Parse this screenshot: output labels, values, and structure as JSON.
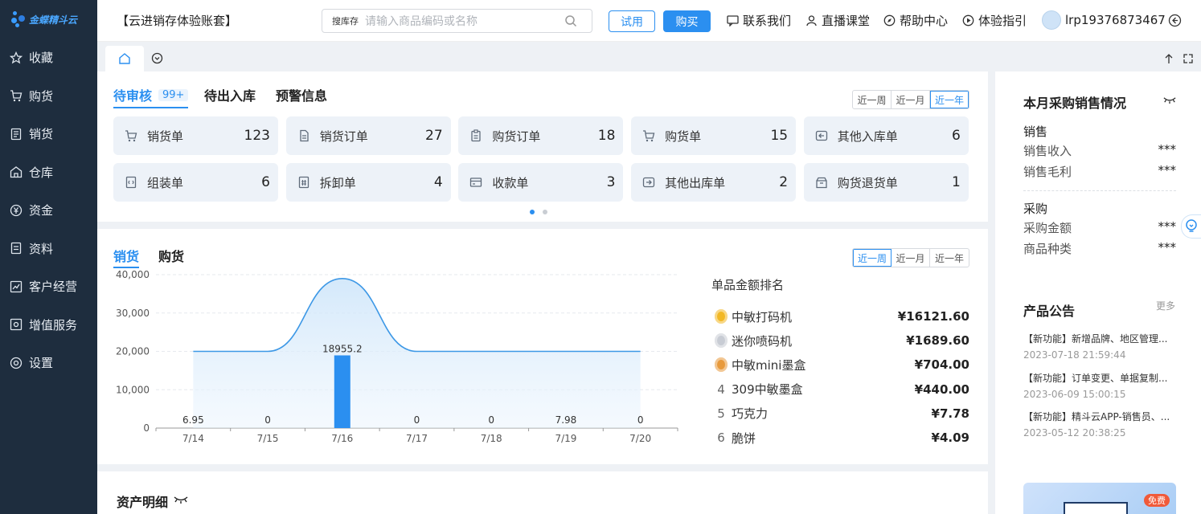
{
  "app": {
    "logo_text": "金蝶精斗云",
    "account_title": "【云进销存体验账套】"
  },
  "sidebar": {
    "items": [
      {
        "label": "收藏",
        "icon": "star-icon"
      },
      {
        "label": "购货",
        "icon": "cart-icon"
      },
      {
        "label": "销货",
        "icon": "receipt-icon"
      },
      {
        "label": "仓库",
        "icon": "warehouse-icon"
      },
      {
        "label": "资金",
        "icon": "yen-icon"
      },
      {
        "label": "资料",
        "icon": "document-icon"
      },
      {
        "label": "客户经营",
        "icon": "chart-icon"
      },
      {
        "label": "增值服务",
        "icon": "service-icon"
      },
      {
        "label": "设置",
        "icon": "gear-icon"
      }
    ]
  },
  "topbar": {
    "search_tag": "搜库存",
    "search_placeholder": "请输入商品编码或名称",
    "try_label": "试用",
    "buy_label": "购买",
    "contact_label": "联系我们",
    "live_label": "直播课堂",
    "help_label": "帮助中心",
    "guide_label": "体验指引",
    "user_label": "lrp19376873467"
  },
  "pending": {
    "tabs": [
      {
        "label": "待审核",
        "badge": "99+"
      },
      {
        "label": "待出入库"
      },
      {
        "label": "预警信息"
      }
    ],
    "ranges": [
      "近一周",
      "近一月",
      "近一年"
    ],
    "active_range": 2,
    "tiles": [
      {
        "label": "销货单",
        "value": "123",
        "icon": "cart-icon"
      },
      {
        "label": "销货订单",
        "value": "27",
        "icon": "order-icon"
      },
      {
        "label": "购货订单",
        "value": "18",
        "icon": "clipboard-icon"
      },
      {
        "label": "购货单",
        "value": "15",
        "icon": "cart-icon"
      },
      {
        "label": "其他入库单",
        "value": "6",
        "icon": "inbound-icon"
      },
      {
        "label": "组装单",
        "value": "6",
        "icon": "assembly-icon"
      },
      {
        "label": "拆卸单",
        "value": "4",
        "icon": "disassembly-icon"
      },
      {
        "label": "收款单",
        "value": "3",
        "icon": "card-icon"
      },
      {
        "label": "其他出库单",
        "value": "2",
        "icon": "outbound-icon"
      },
      {
        "label": "购货退货单",
        "value": "1",
        "icon": "return-icon"
      }
    ],
    "pages": 2,
    "current_page": 0
  },
  "sales": {
    "tabs": [
      "销货",
      "购货"
    ],
    "ranges": [
      "近一周",
      "近一月",
      "近一年"
    ],
    "active_range": 0,
    "ranking_title": "单品金额排名",
    "ranking": [
      {
        "rank": "1",
        "name": "中敏打码机",
        "amount": "¥16121.60",
        "medal": "#f2b825"
      },
      {
        "rank": "2",
        "name": "迷你喷码机",
        "amount": "¥1689.60",
        "medal": "#c8ccd4"
      },
      {
        "rank": "3",
        "name": "中敏mini墨盒",
        "amount": "¥704.00",
        "medal": "#e89a3c"
      },
      {
        "rank": "4",
        "name": "309中敏墨盒",
        "amount": "¥440.00"
      },
      {
        "rank": "5",
        "name": "巧克力",
        "amount": "¥7.78"
      },
      {
        "rank": "6",
        "name": "脆饼",
        "amount": "¥4.09"
      }
    ]
  },
  "chart_data": {
    "type": "bar",
    "categories": [
      "7/14",
      "7/15",
      "7/16",
      "7/17",
      "7/18",
      "7/19",
      "7/20"
    ],
    "values": [
      6.95,
      0,
      18955.2,
      0,
      0,
      7.98,
      0
    ],
    "value_labels": [
      "6.95",
      "0",
      "18955.2",
      "0",
      "0",
      "7.98",
      "0"
    ],
    "line_series": [
      20000,
      20000,
      39000,
      20000,
      20000,
      20000,
      20000
    ],
    "yticks": [
      "0",
      "10,000",
      "20,000",
      "30,000",
      "40,000"
    ],
    "ylim": [
      0,
      40000
    ],
    "bar_color": "#2b8ff0",
    "line_color": "#3d98e6"
  },
  "assets": {
    "title": "资产明细"
  },
  "right_panel": {
    "title": "本月采购销售情况",
    "sales_heading": "销售",
    "sales_rows": [
      {
        "label": "销售收入",
        "value": "***"
      },
      {
        "label": "销售毛利",
        "value": "***"
      }
    ],
    "purchase_heading": "采购",
    "purchase_rows": [
      {
        "label": "采购金额",
        "value": "***"
      },
      {
        "label": "商品种类",
        "value": "***"
      }
    ],
    "notice_title": "产品公告",
    "more_label": "更多",
    "notices": [
      {
        "text": "【新功能】新增品牌、地区管理...",
        "date": "2023-07-18 21:59:44"
      },
      {
        "text": "【新功能】订单变更、单据复制...",
        "date": "2023-06-09 15:00:15"
      },
      {
        "text": "【新功能】精斗云APP-销售员、...",
        "date": "2023-05-12 20:38:25"
      }
    ],
    "promo_badge": "免费"
  }
}
